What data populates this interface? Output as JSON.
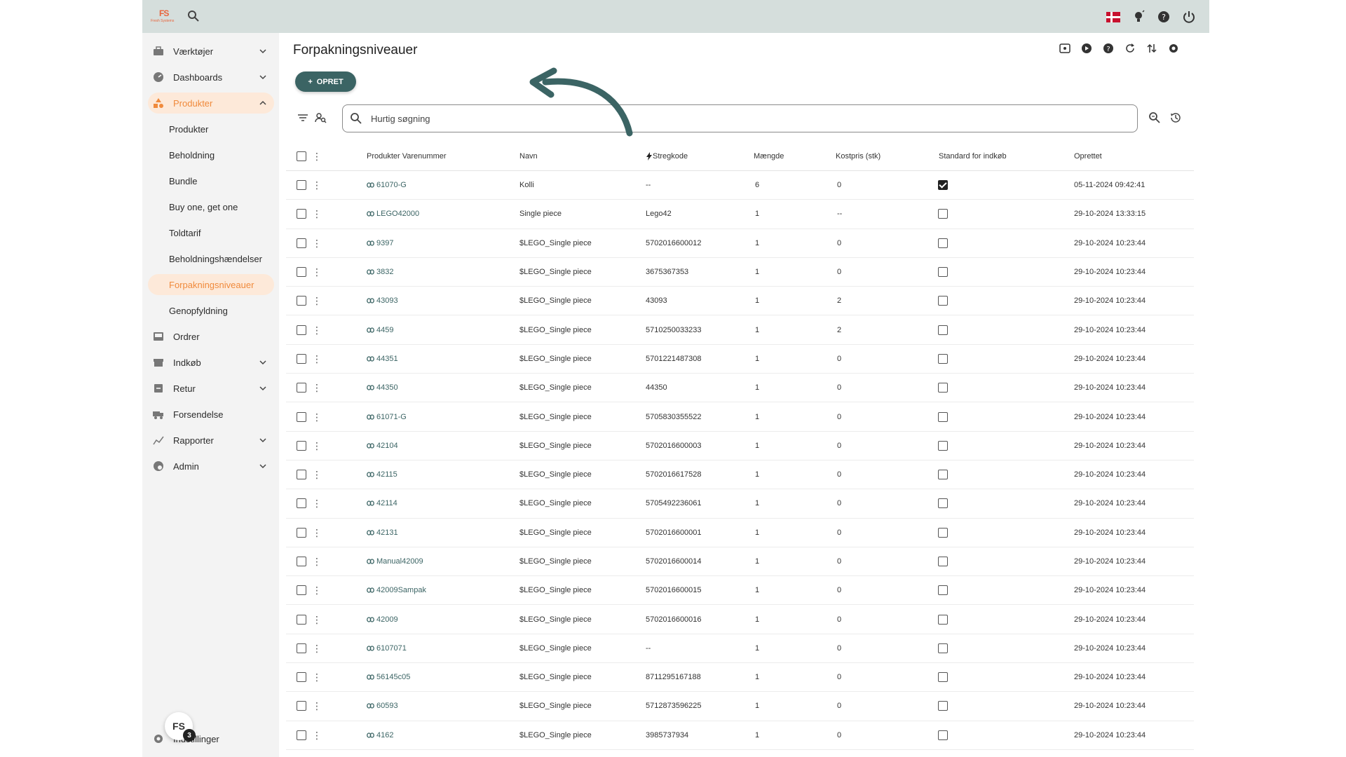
{
  "topbar": {
    "logo_text": "FS",
    "logo_sub": "Fresh Systems"
  },
  "sidebar": {
    "items": [
      {
        "label": "Værktøjer",
        "icon": "toolbox-icon",
        "chevron": "down"
      },
      {
        "label": "Dashboards",
        "icon": "gauge-icon",
        "chevron": "down"
      },
      {
        "label": "Produkter",
        "icon": "shapes-icon",
        "chevron": "up",
        "active": true
      },
      {
        "label": "Ordrer",
        "icon": "inbox-icon"
      },
      {
        "label": "Indkøb",
        "icon": "store-icon",
        "chevron": "down"
      },
      {
        "label": "Retur",
        "icon": "return-box-icon",
        "chevron": "down"
      },
      {
        "label": "Forsendelse",
        "icon": "truck-icon"
      },
      {
        "label": "Rapporter",
        "icon": "chart-icon",
        "chevron": "down"
      },
      {
        "label": "Admin",
        "icon": "admin-icon",
        "chevron": "down"
      }
    ],
    "sub_items": [
      {
        "label": "Produkter"
      },
      {
        "label": "Beholdning"
      },
      {
        "label": "Bundle"
      },
      {
        "label": "Buy one, get one"
      },
      {
        "label": "Toldtarif"
      },
      {
        "label": "Beholdningshændelser"
      },
      {
        "label": "Forpakningsniveauer",
        "active": true
      },
      {
        "label": "Genopfyldning"
      }
    ],
    "settings_label": "Indstillinger",
    "fab_label": "FS",
    "fab_badge": "3"
  },
  "main": {
    "title": "Forpakningsniveauer",
    "create_label": "OPRET",
    "search_placeholder": "Hurtig søgning"
  },
  "table": {
    "columns": [
      "Produkter Varenummer",
      "Navn",
      "Stregkode",
      "Mængde",
      "Kostpris (stk)",
      "Standard for indkøb",
      "Oprettet"
    ],
    "rows": [
      {
        "sku": "61070-G",
        "name": "Kolli",
        "barcode": "--",
        "qty": "6",
        "cost": "0",
        "std": true,
        "created": "05-11-2024 09:42:41"
      },
      {
        "sku": "LEGO42000",
        "name": "Single piece",
        "barcode": "Lego42",
        "qty": "1",
        "cost": "--",
        "std": false,
        "created": "29-10-2024 13:33:15"
      },
      {
        "sku": "9397",
        "name": "$LEGO_Single piece",
        "barcode": "5702016600012",
        "qty": "1",
        "cost": "0",
        "std": false,
        "created": "29-10-2024 10:23:44"
      },
      {
        "sku": "3832",
        "name": "$LEGO_Single piece",
        "barcode": "3675367353",
        "qty": "1",
        "cost": "0",
        "std": false,
        "created": "29-10-2024 10:23:44"
      },
      {
        "sku": "43093",
        "name": "$LEGO_Single piece",
        "barcode": "43093",
        "qty": "1",
        "cost": "2",
        "std": false,
        "created": "29-10-2024 10:23:44"
      },
      {
        "sku": "4459",
        "name": "$LEGO_Single piece",
        "barcode": "5710250033233",
        "qty": "1",
        "cost": "2",
        "std": false,
        "created": "29-10-2024 10:23:44"
      },
      {
        "sku": "44351",
        "name": "$LEGO_Single piece",
        "barcode": "5701221487308",
        "qty": "1",
        "cost": "0",
        "std": false,
        "created": "29-10-2024 10:23:44"
      },
      {
        "sku": "44350",
        "name": "$LEGO_Single piece",
        "barcode": "44350",
        "qty": "1",
        "cost": "0",
        "std": false,
        "created": "29-10-2024 10:23:44"
      },
      {
        "sku": "61071-G",
        "name": "$LEGO_Single piece",
        "barcode": "5705830355522",
        "qty": "1",
        "cost": "0",
        "std": false,
        "created": "29-10-2024 10:23:44"
      },
      {
        "sku": "42104",
        "name": "$LEGO_Single piece",
        "barcode": "5702016600003",
        "qty": "1",
        "cost": "0",
        "std": false,
        "created": "29-10-2024 10:23:44"
      },
      {
        "sku": "42115",
        "name": "$LEGO_Single piece",
        "barcode": "5702016617528",
        "qty": "1",
        "cost": "0",
        "std": false,
        "created": "29-10-2024 10:23:44"
      },
      {
        "sku": "42114",
        "name": "$LEGO_Single piece",
        "barcode": "5705492236061",
        "qty": "1",
        "cost": "0",
        "std": false,
        "created": "29-10-2024 10:23:44"
      },
      {
        "sku": "42131",
        "name": "$LEGO_Single piece",
        "barcode": "5702016600001",
        "qty": "1",
        "cost": "0",
        "std": false,
        "created": "29-10-2024 10:23:44"
      },
      {
        "sku": "Manual42009",
        "name": "$LEGO_Single piece",
        "barcode": "5702016600014",
        "qty": "1",
        "cost": "0",
        "std": false,
        "created": "29-10-2024 10:23:44"
      },
      {
        "sku": "42009Sampak",
        "name": "$LEGO_Single piece",
        "barcode": "5702016600015",
        "qty": "1",
        "cost": "0",
        "std": false,
        "created": "29-10-2024 10:23:44"
      },
      {
        "sku": "42009",
        "name": "$LEGO_Single piece",
        "barcode": "5702016600016",
        "qty": "1",
        "cost": "0",
        "std": false,
        "created": "29-10-2024 10:23:44"
      },
      {
        "sku": "6107071",
        "name": "$LEGO_Single piece",
        "barcode": "--",
        "qty": "1",
        "cost": "0",
        "std": false,
        "created": "29-10-2024 10:23:44"
      },
      {
        "sku": "56145c05",
        "name": "$LEGO_Single piece",
        "barcode": "8711295167188",
        "qty": "1",
        "cost": "0",
        "std": false,
        "created": "29-10-2024 10:23:44"
      },
      {
        "sku": "60593",
        "name": "$LEGO_Single piece",
        "barcode": "5712873596225",
        "qty": "1",
        "cost": "0",
        "std": false,
        "created": "29-10-2024 10:23:44"
      },
      {
        "sku": "4162",
        "name": "$LEGO_Single piece",
        "barcode": "3985737934",
        "qty": "1",
        "cost": "0",
        "std": false,
        "created": "29-10-2024 10:23:44"
      }
    ]
  },
  "colors": {
    "accent": "#3b6464",
    "active": "#f08a3c",
    "active_bg": "#fde9d9",
    "topbar": "#d5dedc"
  }
}
